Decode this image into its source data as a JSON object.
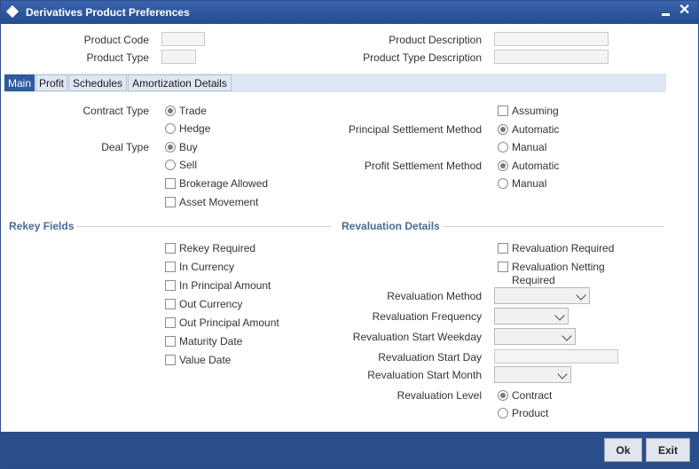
{
  "window": {
    "title": "Derivatives Product Preferences"
  },
  "header": {
    "product_code_label": "Product Code",
    "product_type_label": "Product Type",
    "product_description_label": "Product Description",
    "product_type_description_label": "Product Type Description"
  },
  "tabs": [
    {
      "label": "Main",
      "active": true
    },
    {
      "label": "Profit",
      "active": false
    },
    {
      "label": "Schedules",
      "active": false
    },
    {
      "label": "Amortization Details",
      "active": false
    }
  ],
  "main": {
    "contract_type_label": "Contract Type",
    "contract_type_options": [
      "Trade",
      "Hedge"
    ],
    "deal_type_label": "Deal Type",
    "deal_type_options": [
      "Buy",
      "Sell"
    ],
    "brokerage_allowed": "Brokerage Allowed",
    "asset_movement": "Asset Movement",
    "assuming": "Assuming",
    "principal_settlement_label": "Principal Settlement Method",
    "principal_settlement_options": [
      "Automatic",
      "Manual"
    ],
    "profit_settlement_label": "Profit Settlement Method",
    "profit_settlement_options": [
      "Automatic",
      "Manual"
    ]
  },
  "rekey": {
    "title": "Rekey Fields",
    "items": [
      "Rekey Required",
      "In Currency",
      "In Principal Amount",
      "Out Currency",
      "Out Principal Amount",
      "Maturity Date",
      "Value Date"
    ]
  },
  "revaluation": {
    "title": "Revaluation Details",
    "required": "Revaluation Required",
    "netting_required_1": "Revaluation Netting",
    "netting_required_2": "Required",
    "method_label": "Revaluation Method",
    "frequency_label": "Revaluation Frequency",
    "start_weekday_label": "Revaluation Start Weekday",
    "start_day_label": "Revaluation Start Day",
    "start_month_label": "Revaluation Start Month",
    "level_label": "Revaluation Level",
    "level_options": [
      "Contract",
      "Product"
    ]
  },
  "footer": {
    "ok": "Ok",
    "exit": "Exit"
  }
}
